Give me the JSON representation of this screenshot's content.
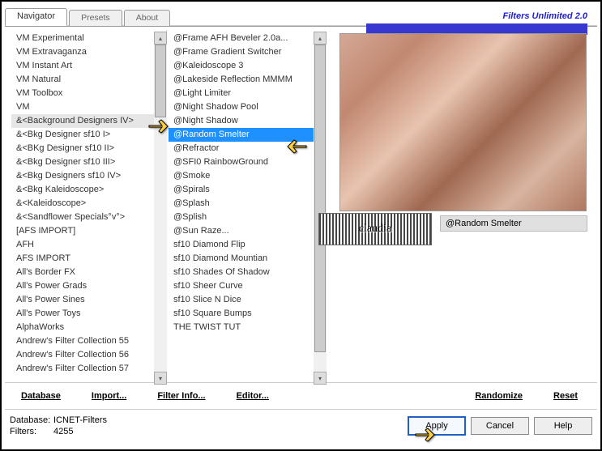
{
  "header": {
    "title": "Filters Unlimited 2.0",
    "tabs": [
      "Navigator",
      "Presets",
      "About"
    ],
    "active_tab": 0
  },
  "categories": [
    "VM Experimental",
    "VM Extravaganza",
    "VM Instant Art",
    "VM Natural",
    "VM Toolbox",
    "VM",
    "&<Background Designers IV>",
    "&<Bkg Designer sf10 I>",
    "&<BKg Designer sf10 II>",
    "&<Bkg Designer sf10 III>",
    "&<Bkg Designers sf10 IV>",
    "&<Bkg Kaleidoscope>",
    "&<Kaleidoscope>",
    "&<Sandflower Specials°v°>",
    "[AFS IMPORT]",
    "AFH",
    "AFS IMPORT",
    "All's Border FX",
    "All's Power Grads",
    "All's Power Sines",
    "All's Power Toys",
    "AlphaWorks",
    "Andrew's Filter Collection 55",
    "Andrew's Filter Collection 56",
    "Andrew's Filter Collection 57"
  ],
  "categories_selected": 6,
  "filters": [
    "@Frame AFH Beveler 2.0a...",
    "@Frame Gradient Switcher",
    "@Kaleidoscope 3",
    "@Lakeside Reflection MMMM",
    "@Light Limiter",
    "@Night Shadow Pool",
    "@Night Shadow",
    "@Random Smelter",
    "@Refractor",
    "@SFI0 RainbowGround",
    "@Smoke",
    "@Spirals",
    "@Splash",
    "@Splish",
    "@Sun Raze...",
    "sf10 Diamond Flip",
    "sf10 Diamond Mountian",
    "sf10 Shades Of Shadow",
    "sf10 Sheer Curve",
    "sf10 Slice N Dice",
    "sf10 Square Bumps",
    "THE TWIST TUT"
  ],
  "filters_selected": 7,
  "toolbar": {
    "database": "Database",
    "import": "Import...",
    "filterinfo": "Filter Info...",
    "editor": "Editor...",
    "randomize": "Randomize",
    "reset": "Reset"
  },
  "footer": {
    "db_label": "Database:",
    "db_value": "ICNET-Filters",
    "count_label": "Filters:",
    "count_value": "4255",
    "apply": "Apply",
    "cancel": "Cancel",
    "help": "Help"
  },
  "preview_label": "@Random Smelter",
  "stamp": "claudia"
}
